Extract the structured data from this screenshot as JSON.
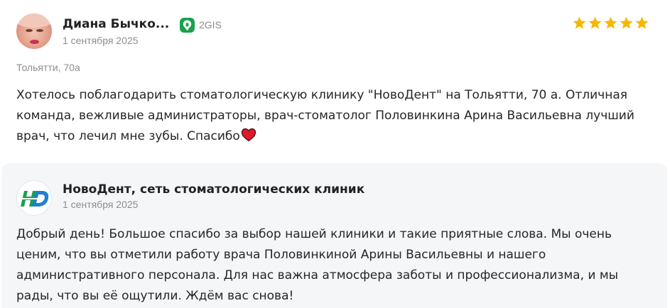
{
  "review": {
    "author": "Диана Бычко...",
    "source": "2GIS",
    "source_icon": "2gis-icon",
    "date": "1 сентября 2025",
    "rating": 5,
    "rating_max": 5,
    "star_color": "#f5b700",
    "location": "Тольятти, 70а",
    "text": "Хотелось поблагодарить стоматологическую клинику \"НовоДент\" на Тольятти, 70 а. Отличная команда, вежливые администраторы, врач-стоматолог Половинкина Арина Васильевна лучший врач, что лечил мне зубы. Спасибо",
    "text_emoji": "heart-icon"
  },
  "reply": {
    "author": "НовоДент, сеть стоматологических клиник",
    "logo_icon": "novodent-logo",
    "date": "1 сентября 2025",
    "text": "Добрый день! Большое спасибо за выбор нашей клиники и такие приятные слова. Мы очень ценим, что вы отметили работу врача Половинкиной Арины Васильевны и нашего административного персонала. Для нас важна атмосфера заботы и профессионализма, и мы рады, что вы её ощутили. Ждём вас снова!"
  },
  "colors": {
    "brand_green": "#19a24a",
    "reply_background": "#f5f6f8",
    "muted_text": "#8d8d8d"
  }
}
